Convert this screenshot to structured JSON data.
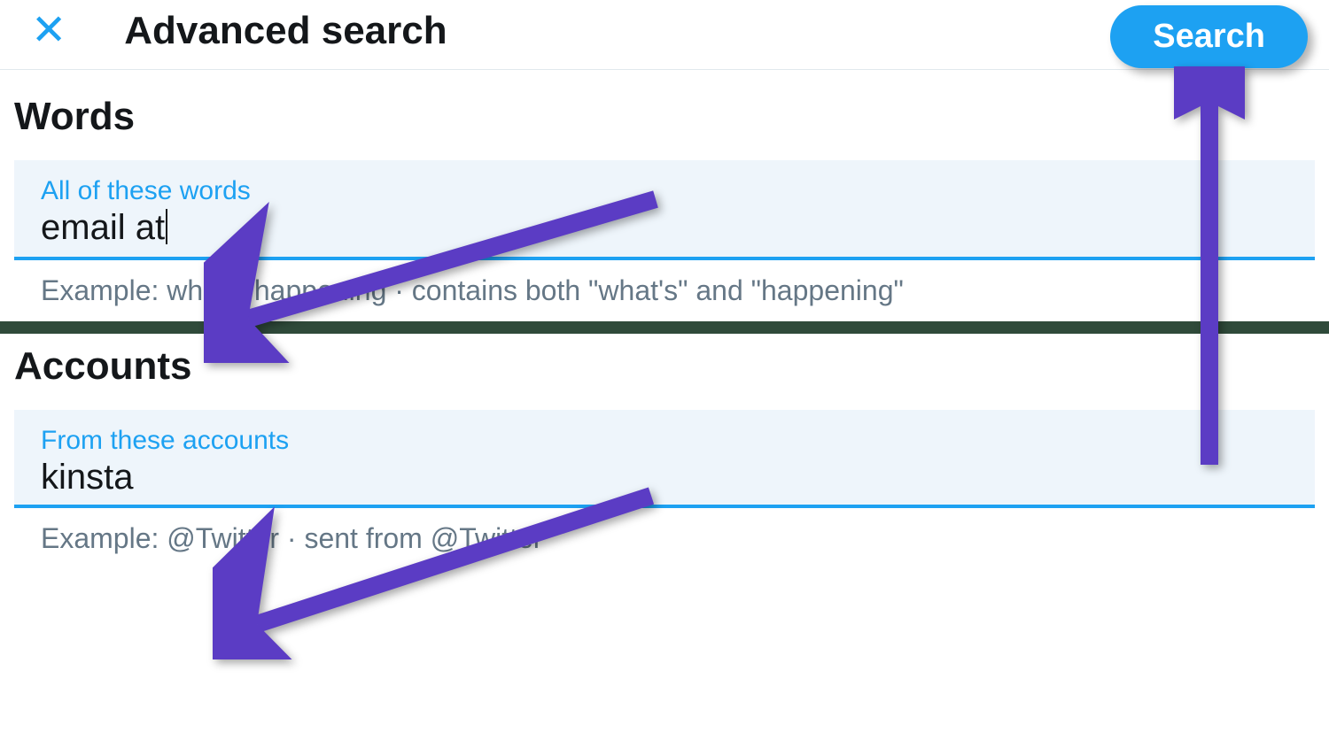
{
  "header": {
    "title": "Advanced search",
    "search_button_label": "Search"
  },
  "sections": {
    "words": {
      "title": "Words",
      "field_label": "All of these words",
      "field_value": "email at",
      "example": "Example: what's happening · contains both \"what's\" and \"happening\""
    },
    "accounts": {
      "title": "Accounts",
      "field_label": "From these accounts",
      "field_value": "kinsta",
      "example": "Example: @Twitter · sent from @Twitter"
    }
  },
  "colors": {
    "accent": "#1da1f2",
    "annotation": "#5b3cc4",
    "text": "#14171a",
    "muted": "#657786",
    "input_bg": "#eef5fb"
  }
}
